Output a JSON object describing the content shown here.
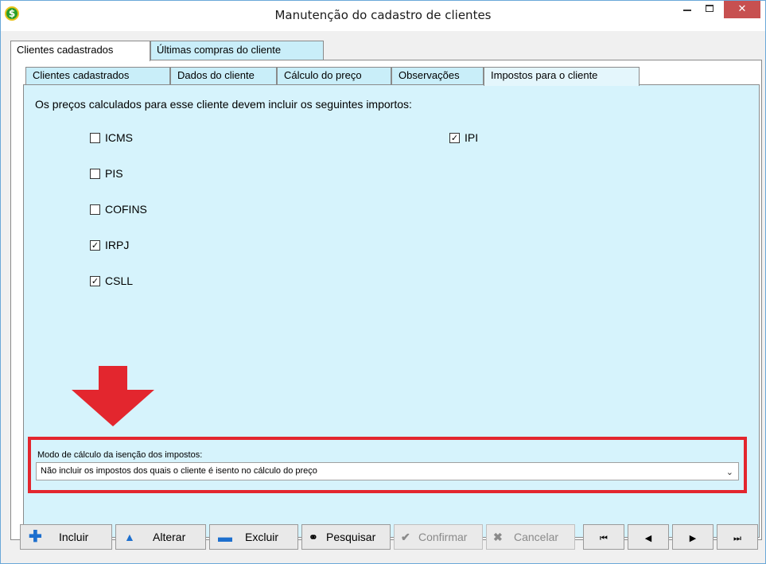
{
  "window": {
    "title": "Manutenção do cadastro de clientes",
    "close_glyph": "✕"
  },
  "outer_tabs": [
    {
      "label": "Clientes cadastrados",
      "active": true
    },
    {
      "label": "Últimas compras do cliente",
      "active": false
    }
  ],
  "inner_tabs": [
    {
      "label": "Clientes cadastrados",
      "active": false
    },
    {
      "label": "Dados do cliente",
      "active": false
    },
    {
      "label": "Cálculo do preço",
      "active": false
    },
    {
      "label": "Observações",
      "active": false
    },
    {
      "label": "Impostos para o cliente",
      "active": true
    }
  ],
  "taxes": {
    "prompt": "Os preços calculados para esse cliente devem incluir os seguintes importos:",
    "items": [
      {
        "label": "ICMS",
        "checked": false
      },
      {
        "label": "PIS",
        "checked": false
      },
      {
        "label": "COFINS",
        "checked": false
      },
      {
        "label": "IRPJ",
        "checked": true
      },
      {
        "label": "CSLL",
        "checked": true
      },
      {
        "label": "IPI",
        "checked": true
      }
    ]
  },
  "exemption_mode": {
    "label": "Modo de cálculo da isenção dos impostos:",
    "value": "Não incluir os impostos dos quais o cliente é isento no cálculo do preço"
  },
  "toolbar": {
    "incluir": "Incluir",
    "alterar": "Alterar",
    "excluir": "Excluir",
    "pesquisar": "Pesquisar",
    "confirmar": "Confirmar",
    "cancelar": "Cancelar",
    "first_glyph": "⏮",
    "prev_glyph": "◀",
    "next_glyph": "▶",
    "last_glyph": "⏭"
  },
  "colors": {
    "panel_bg": "#d6f3fc",
    "highlight_red": "#e3262e",
    "plus_blue": "#1d6fce"
  },
  "icons": {
    "app": "dollar-coin-icon",
    "annotation": "red-down-arrow"
  }
}
